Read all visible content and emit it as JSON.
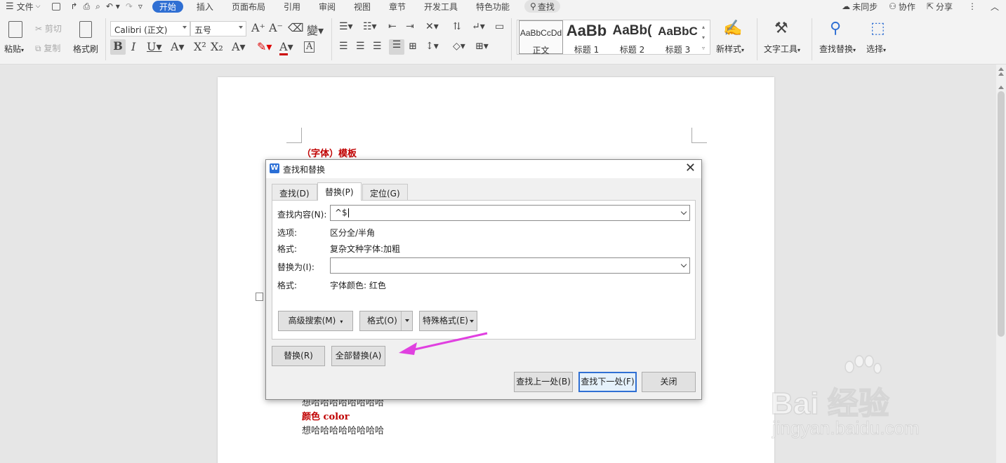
{
  "menubar": {
    "file": "文件",
    "tabs": [
      "开始",
      "插入",
      "页面布局",
      "引用",
      "审阅",
      "视图",
      "章节",
      "开发工具",
      "特色功能"
    ],
    "active_tab": "开始",
    "search": "查找",
    "right": {
      "sync": "未同步",
      "collab": "协作",
      "share": "分享"
    }
  },
  "ribbon": {
    "paste": "粘贴",
    "cut": "剪切",
    "copy": "复制",
    "format_painter": "格式刷",
    "font_name": "Calibri (正文)",
    "font_size": "五号",
    "styles": [
      {
        "preview": "AaBbCcDd",
        "label": "正文"
      },
      {
        "preview": "AaBb",
        "label": "标题 1"
      },
      {
        "preview": "AaBb(",
        "label": "标题 2"
      },
      {
        "preview": "AaBbC",
        "label": "标题 3"
      }
    ],
    "new_style": "新样式",
    "text_tools": "文字工具",
    "find_replace": "查找替换",
    "select": "选择"
  },
  "document": {
    "heading": "（字体）模板",
    "line1": "想哈哈哈哈哈哈哈哈",
    "color_label": "颜色 color",
    "line2": "想哈哈哈哈哈哈哈哈"
  },
  "dialog": {
    "title": "查找和替换",
    "tabs": [
      "查找(D)",
      "替换(P)",
      "定位(G)"
    ],
    "active_tab": "替换(P)",
    "find_label": "查找内容(N):",
    "find_value": "^$",
    "options_label": "选项:",
    "options_value": "区分全/半角",
    "format_label": "格式:",
    "find_format_value": "复杂文种字体:加粗",
    "replace_label": "替换为(I):",
    "replace_value": "",
    "replace_format_value": "字体颜色: 红色",
    "advanced_button": "高级搜索(M)",
    "format_button": "格式(O)",
    "special_button": "特殊格式(E)",
    "replace_button": "替换(R)",
    "replace_all_button": "全部替换(A)",
    "find_prev_button": "查找上一处(B)",
    "find_next_button": "查找下一处(F)",
    "close_button": "关闭"
  },
  "watermark": {
    "brand": "Bai 经验",
    "url": "jingyan.baidu.com"
  },
  "colors": {
    "accent": "#2f6fd3",
    "doc_red": "#c00000",
    "arrow": "#e040e0"
  }
}
